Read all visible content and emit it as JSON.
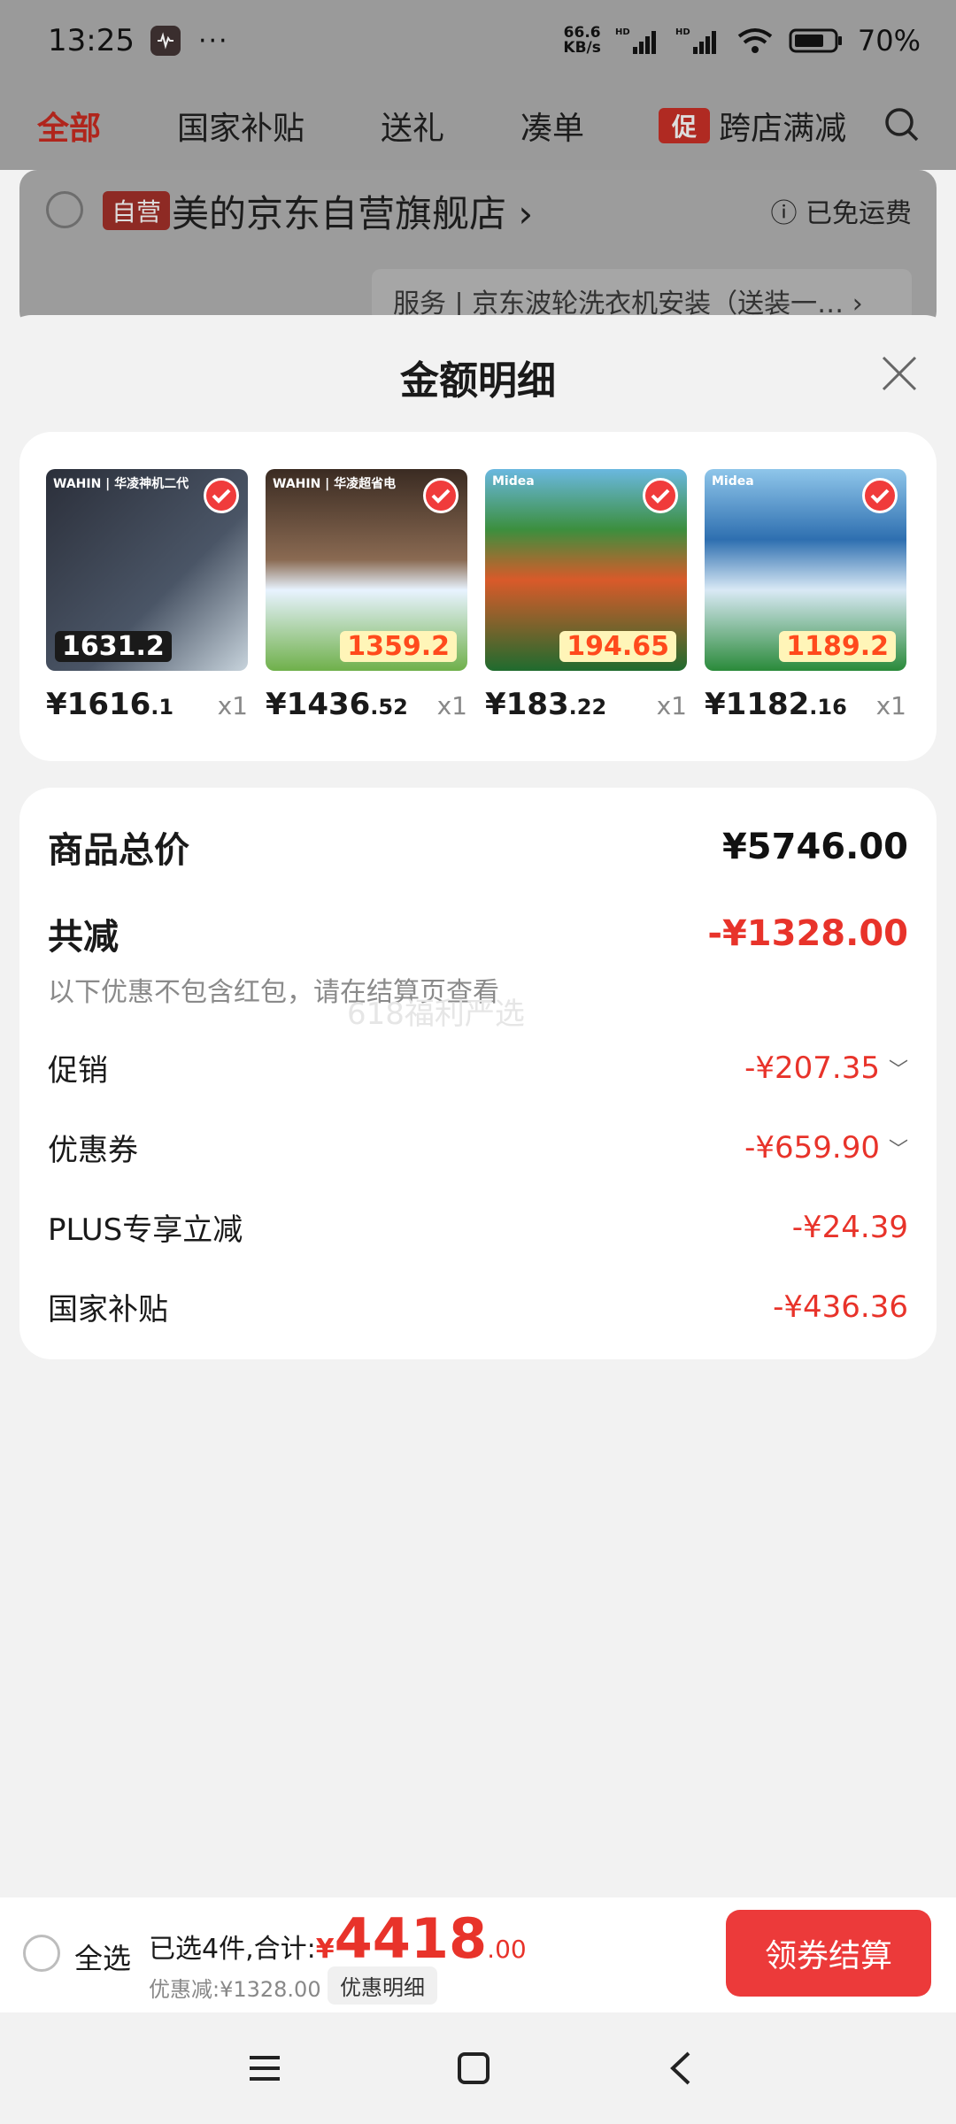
{
  "status_bar": {
    "time": "13:25",
    "more": "···",
    "net_speed_top": "66.6",
    "net_speed_unit": "KB/s",
    "battery_percent": "70%",
    "icons": [
      "hd-signal-icon",
      "hd-signal-icon",
      "wifi-icon",
      "battery-icon"
    ]
  },
  "background_page": {
    "tabs": [
      {
        "label": "全部",
        "active": true
      },
      {
        "label": "国家补贴"
      },
      {
        "label": "送礼"
      },
      {
        "label": "凑单"
      },
      {
        "label": "跨店满减",
        "badge": "促"
      }
    ],
    "shop": {
      "tag": "自营",
      "name": "美的京东自营旗舰店 ›",
      "shipping": "ⓘ 已免运费",
      "service": "服务 | 京东波轮洗衣机安装（送装一…  ›"
    }
  },
  "sheet": {
    "title": "金额明细",
    "products": [
      {
        "brand": "WAHIN | 华凌神机二代",
        "tag": "1631.2",
        "price_main": "¥1616",
        "price_dec": ".1",
        "qty": "x1"
      },
      {
        "brand": "WAHIN | 华凌超省电",
        "tag": "1359.2",
        "price_main": "¥1436",
        "price_dec": ".52",
        "qty": "x1"
      },
      {
        "brand": "Midea",
        "tag": "194.65",
        "price_main": "¥183",
        "price_dec": ".22",
        "qty": "x1"
      },
      {
        "brand": "Midea",
        "tag": "1189.2",
        "price_main": "¥1182",
        "price_dec": ".16",
        "qty": "x1"
      }
    ],
    "details": {
      "total_label": "商品总价",
      "total_value": "¥5746.00",
      "reduce_label": "共减",
      "reduce_value": "-¥1328.00",
      "note": "以下优惠不包含红包，请在结算页查看",
      "watermark": "618福利严选",
      "rows": [
        {
          "label": "促销",
          "value": "-¥207.35",
          "expandable": true
        },
        {
          "label": "优惠券",
          "value": "-¥659.90",
          "expandable": true
        },
        {
          "label": "PLUS专享立减",
          "value": "-¥24.39",
          "expandable": false
        },
        {
          "label": "国家补贴",
          "value": "-¥436.36",
          "expandable": false
        }
      ]
    }
  },
  "bottom_bar": {
    "select_all": "全选",
    "selected_text": "已选4件,合计:",
    "currency": "¥",
    "total_int": "4418",
    "total_dec": ".00",
    "discount_text": "优惠减:¥1328.00",
    "detail_button": "优惠明细",
    "checkout_button": "领券结算"
  },
  "colors": {
    "accent_red": "#e8332a",
    "checkout_bg": "#ec3a3a"
  }
}
